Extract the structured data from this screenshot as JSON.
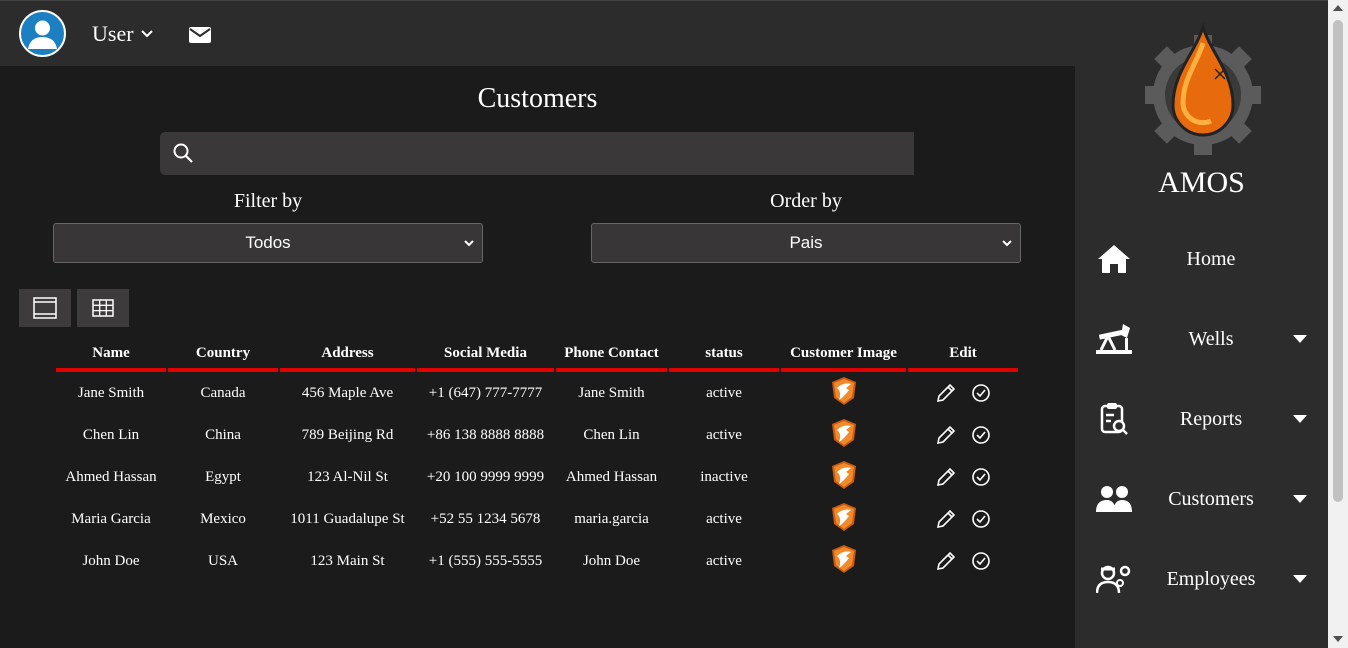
{
  "header": {
    "user_label": "User",
    "avatar_icon": "user-avatar-icon",
    "mail_icon": "mail-icon"
  },
  "main": {
    "title": "Customers",
    "search": {
      "placeholder": "",
      "value": ""
    },
    "filter": {
      "label": "Filter by",
      "selected": "Todos"
    },
    "order": {
      "label": "Order by",
      "selected": "Pais"
    },
    "view_buttons": [
      "list-view-icon",
      "grid-view-icon"
    ],
    "table": {
      "columns": [
        "Name",
        "Country",
        "Address",
        "Social Media",
        "Phone Contact",
        "status",
        "Customer Image",
        "Edit"
      ],
      "rows": [
        [
          "Jane Smith",
          "Canada",
          "456 Maple Ave",
          "+1 (647) 777-7777",
          "Jane Smith",
          "active"
        ],
        [
          "Chen Lin",
          "China",
          "789 Beijing Rd",
          "+86 138 8888 8888",
          "Chen Lin",
          "active"
        ],
        [
          "Ahmed Hassan",
          "Egypt",
          "123 Al-Nil St",
          "+20 100 9999 9999",
          "Ahmed Hassan",
          "inactive"
        ],
        [
          "Maria Garcia",
          "Mexico",
          "1011 Guadalupe St",
          "+52 55 1234 5678",
          "maria.garcia",
          "active"
        ],
        [
          "John Doe",
          "USA",
          "123 Main St",
          "+1 (555) 555-5555",
          "John Doe",
          "active"
        ]
      ]
    }
  },
  "sidebar": {
    "brand": "AMOS",
    "items": [
      {
        "label": "Home",
        "icon": "home-icon",
        "has_dropdown": false
      },
      {
        "label": "Wells",
        "icon": "oil-pump-icon",
        "has_dropdown": true
      },
      {
        "label": "Reports",
        "icon": "clipboard-search-icon",
        "has_dropdown": true
      },
      {
        "label": "Customers",
        "icon": "users-icon",
        "has_dropdown": true
      },
      {
        "label": "Employees",
        "icon": "worker-gear-icon",
        "has_dropdown": true
      }
    ]
  },
  "colors": {
    "accent_red": "#e00000",
    "topbar": "#2c2c2c",
    "main_bg": "#1b1b1b",
    "avatar_blue": "#1c7fc2",
    "logo_orange": "#f07a10"
  }
}
